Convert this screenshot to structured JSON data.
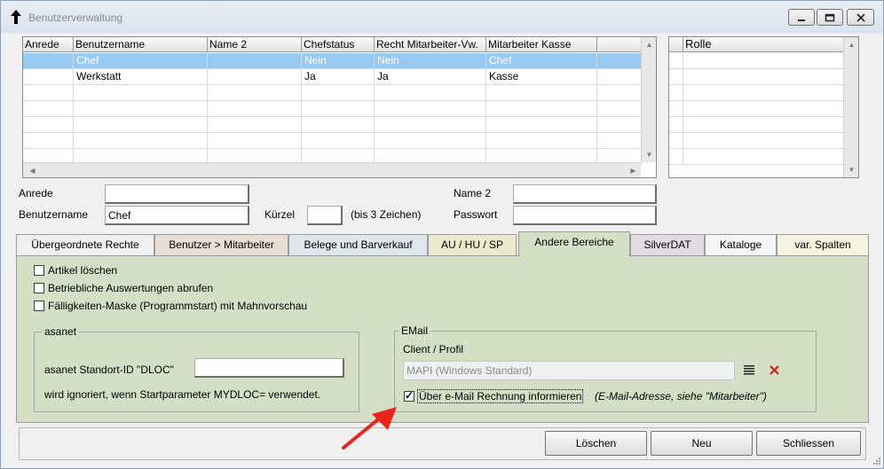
{
  "window": {
    "title": "Benutzerverwaltung"
  },
  "users_grid": {
    "columns": [
      "Anrede",
      "Benutzername",
      "Name 2",
      "Chefstatus",
      "Recht Mitarbeiter-Vw.",
      "Mitarbeiter Kasse"
    ],
    "rows": [
      [
        "",
        "Chef",
        "",
        "Nein",
        "Nein",
        "Chef"
      ],
      [
        "",
        "Werkstatt",
        "",
        "Ja",
        "Ja",
        "Kasse"
      ]
    ],
    "selected_row": 0
  },
  "role_grid": {
    "column": "Rolle"
  },
  "form": {
    "anrede_label": "Anrede",
    "anrede_value": "",
    "benutzername_label": "Benutzername",
    "benutzername_value": "Chef",
    "kuerzel_label": "Kürzel",
    "kuerzel_value": "",
    "kuerzel_hint": "(bis 3 Zeichen)",
    "name2_label": "Name 2",
    "name2_value": "",
    "passwort_label": "Passwort",
    "passwort_value": ""
  },
  "tabs": [
    {
      "label": "Übergeordnete Rechte",
      "color": "#f0f0f0"
    },
    {
      "label": "Benutzer > Mitarbeiter",
      "color": "#e9ded3"
    },
    {
      "label": "Belege und Barverkauf",
      "color": "#dfe6ec"
    },
    {
      "label": "AU / HU / SP",
      "color": "#ece9cd"
    },
    {
      "label": "Andere Bereiche",
      "color": "#d5dfc6"
    },
    {
      "label": "SilverDAT",
      "color": "#e3dbe3"
    },
    {
      "label": "Kataloge",
      "color": "#f6f6f6"
    },
    {
      "label": "var. Spalten",
      "color": "#f6f3df"
    }
  ],
  "active_tab": 4,
  "permissions": [
    {
      "label": "Artikel löschen",
      "checked": false
    },
    {
      "label": "Betriebliche Auswertungen abrufen",
      "checked": false
    },
    {
      "label": "Fälligkeiten-Maske (Programmstart) mit Mahnvorschau",
      "checked": false
    }
  ],
  "asanet": {
    "title": "asanet",
    "standort_label": "asanet Standort-ID \"DLOC\"",
    "standort_value": "",
    "note": "wird ignoriert, wenn Startparameter MYDLOC= verwendet."
  },
  "email": {
    "title": "EMail",
    "client_label": "Client / Profil",
    "client_value": "MAPI (Windows Standard)",
    "inform_label": "Über e-Mail Rechnung informieren",
    "inform_checked": true,
    "inform_hint": "(E-Mail-Adresse, siehe \"Mitarbeiter\")"
  },
  "buttons": {
    "delete": "Löschen",
    "new": "Neu",
    "close": "Schliessen"
  },
  "colors": {
    "panel": "#d5dfc6",
    "selection": "#99c9ef",
    "delete_icon": "#c0281c",
    "annotation_arrow": "#e8241c"
  }
}
